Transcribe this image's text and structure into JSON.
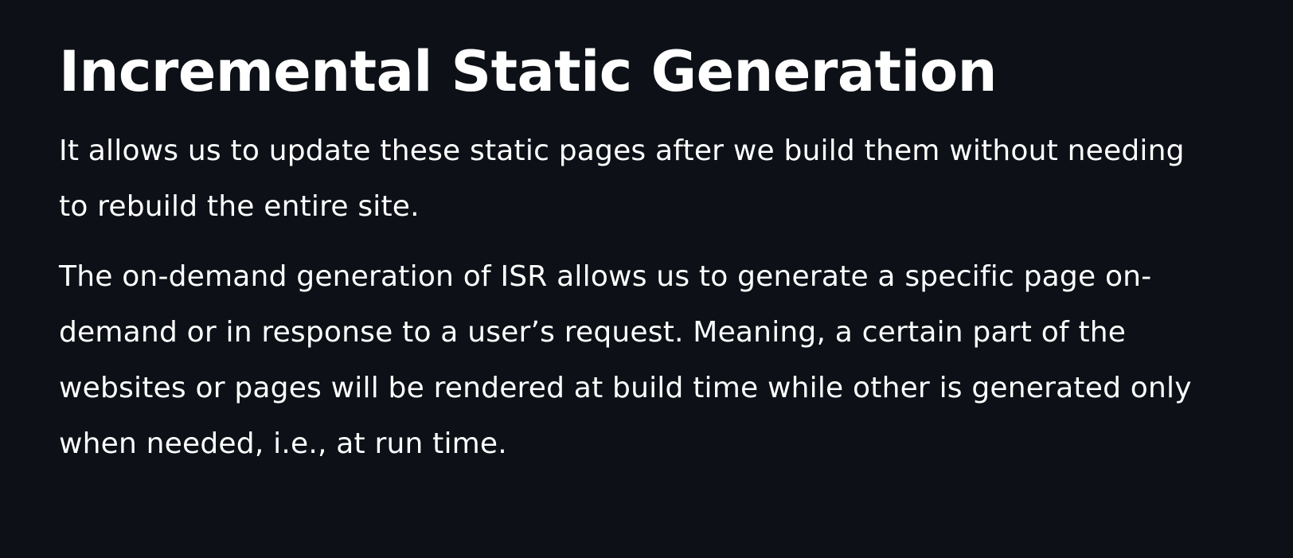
{
  "page": {
    "title": "Incremental Static Generation",
    "paragraphs": [
      "It allows us to update these static pages after we build them without needing to rebuild the entire site.",
      "The on-demand generation of ISR allows us to generate a specific page on-demand or in response to a user’s request. Meaning, a certain part of the websites or pages will be rendered at build time while other is generated only when needed, i.e., at run time."
    ]
  },
  "colors": {
    "background": "#0d1117",
    "text": "#ffffff"
  }
}
